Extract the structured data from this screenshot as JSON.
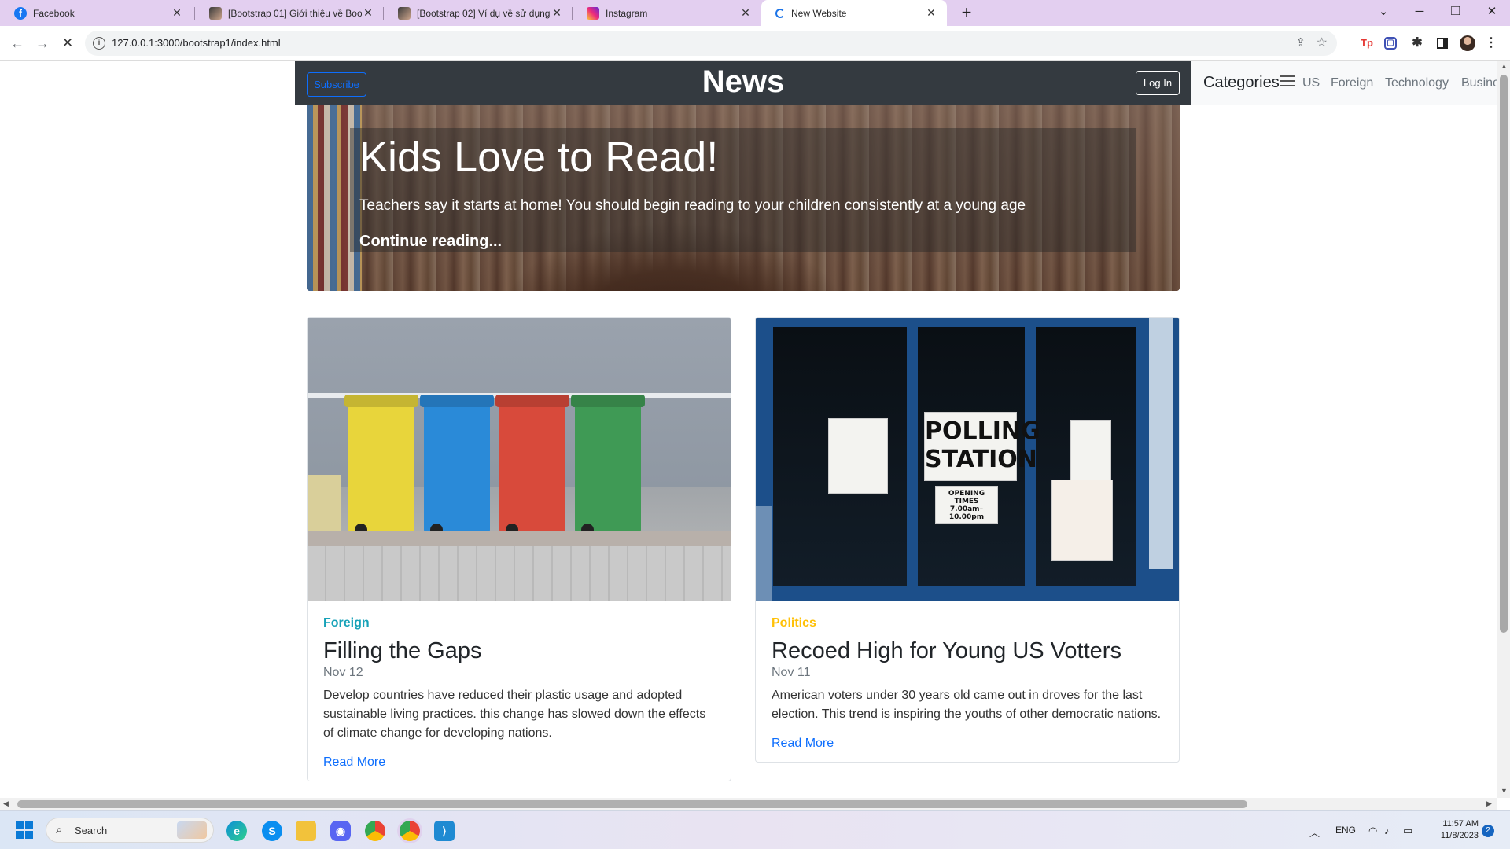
{
  "browser": {
    "tabs": [
      {
        "title": "Facebook",
        "icon": "facebook-icon"
      },
      {
        "title": "[Bootstrap 01] Giới thiệu về Boo",
        "icon": "site-avatar-icon"
      },
      {
        "title": "[Bootstrap 02] Ví dụ về sử dụng",
        "icon": "site-avatar-icon"
      },
      {
        "title": "Instagram",
        "icon": "instagram-icon"
      },
      {
        "title": "New Website",
        "icon": "loading-icon",
        "active": true
      }
    ],
    "new_tab": "+",
    "url": "127.0.0.1:3000/bootstrap1/index.html"
  },
  "page": {
    "navbar": {
      "subscribe_label": "Subscribe",
      "brand": "News",
      "login_label": "Log In"
    },
    "categories": {
      "title": "Categories",
      "links": [
        "US",
        "Foreign",
        "Technology",
        "Busine"
      ]
    },
    "hero": {
      "title": "Kids Love to Read!",
      "text": "Teachers say it starts at home! You should begin reading to your children consistently at a young age",
      "link": "Continue reading..."
    },
    "cards": [
      {
        "category": "Foreign",
        "category_color": "#17a2b8",
        "title": "Filling the Gaps",
        "date": "Nov 12",
        "text": "Develop countries have reduced their plastic usage and adopted sustainable living practices. this change has slowed down the effects of climate change for developing nations.",
        "link": "Read More"
      },
      {
        "category": "Politics",
        "category_color": "#ffc107",
        "title": "Recoed High for Young US Votters",
        "date": "Nov 11",
        "text": "American voters under 30 years old came out in droves for the last election. This trend is inspiring the youths of other democratic nations.",
        "link": "Read More"
      }
    ],
    "poll_sign": {
      "line1": "POLLING",
      "line2": "STATION",
      "hours_title": "OPENING TIMES",
      "hours": "7.00am–10.00pm"
    }
  },
  "taskbar": {
    "search_placeholder": "Search",
    "lang": "ENG",
    "time": "11:57 AM",
    "date": "11/8/2023",
    "notifications": "2"
  }
}
